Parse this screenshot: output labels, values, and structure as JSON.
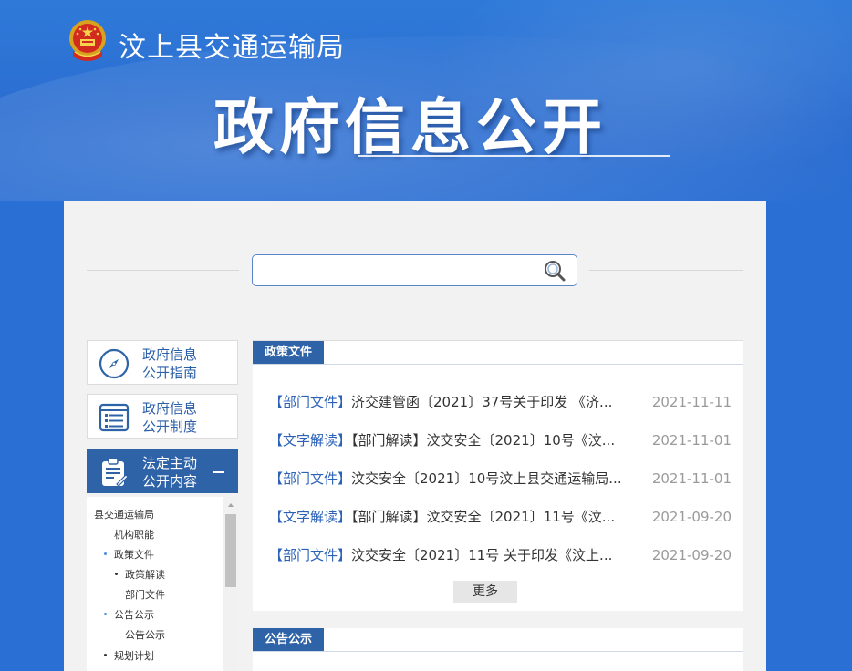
{
  "header": {
    "agency_name": "汶上县交通运输局",
    "page_title": "政府信息公开"
  },
  "search": {
    "value": "",
    "placeholder": ""
  },
  "sidebar": {
    "items": [
      {
        "label_line1": "政府信息",
        "label_line2": "公开指南",
        "icon": "compass-icon"
      },
      {
        "label_line1": "政府信息",
        "label_line2": "公开制度",
        "icon": "list-icon"
      },
      {
        "label_line1": "法定主动",
        "label_line2": "公开内容",
        "icon": "clipboard-edit-icon",
        "expanded": true
      }
    ],
    "tree": [
      {
        "label": "县交通运输局",
        "level": 0
      },
      {
        "label": "机构职能",
        "level": 1
      },
      {
        "label": "政策文件",
        "level": 1,
        "bullet": "blue"
      },
      {
        "label": "政策解读",
        "level": 2,
        "bullet": "dark"
      },
      {
        "label": "部门文件",
        "level": 2
      },
      {
        "label": "公告公示",
        "level": 1,
        "bullet": "blue"
      },
      {
        "label": "公告公示",
        "level": 2
      },
      {
        "label": "规划计划",
        "level": 1,
        "bullet": "dark"
      }
    ]
  },
  "policy_section": {
    "title": "政策文件",
    "rows": [
      {
        "tag": "【部门文件】",
        "title": "济交建管函〔2021〕37号关于印发 《济...",
        "date": "2021-11-11"
      },
      {
        "tag": "【文字解读】",
        "title": "【部门解读】汶交安全〔2021〕10号《汶...",
        "date": "2021-11-01"
      },
      {
        "tag": "【部门文件】",
        "title": "汶交安全〔2021〕10号汶上县交通运输局...",
        "date": "2021-11-01"
      },
      {
        "tag": "【文字解读】",
        "title": "【部门解读】汶交安全〔2021〕11号《汶...",
        "date": "2021-09-20"
      },
      {
        "tag": "【部门文件】",
        "title": "汶交安全〔2021〕11号 关于印发《汶上...",
        "date": "2021-09-20"
      }
    ],
    "more_label": "更多"
  },
  "notice_section": {
    "title": "公告公示"
  },
  "colors": {
    "banner_blue": "#2a6fd4",
    "accent_blue": "#2e63a8",
    "tag_blue": "#2b62b8",
    "date_gray": "#9a9a9a"
  }
}
